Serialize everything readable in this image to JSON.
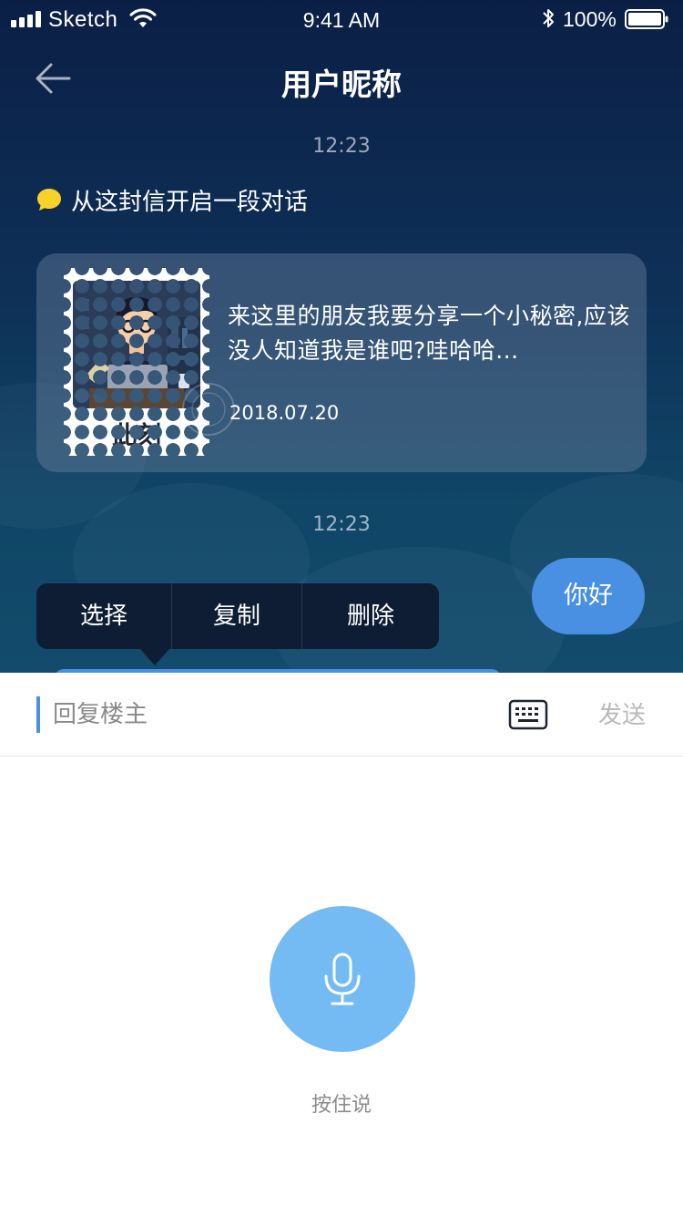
{
  "status_bar": {
    "carrier": "Sketch",
    "time": "9:41 AM",
    "battery": "100%"
  },
  "header": {
    "title": "用户昵称"
  },
  "chat": {
    "timestamps": [
      "12:23",
      "12:23"
    ],
    "intro": "从这封信开启一段对话",
    "letter": {
      "stamp_label": "此刻",
      "excerpt": "来这里的朋友我要分享一个小秘密,应该没人知道我是谁吧?哇哈哈...",
      "date": "2018.07.20"
    },
    "my_message": "你好"
  },
  "context_menu": {
    "items": [
      "选择",
      "复制",
      "删除"
    ]
  },
  "input": {
    "placeholder": "回复楼主",
    "send_label": "发送"
  },
  "voice": {
    "hold_label": "按住说"
  },
  "colors": {
    "accent_blue": "#4a90e2",
    "mic_blue": "#74bbf4",
    "intro_icon_yellow": "#f8d12b"
  }
}
